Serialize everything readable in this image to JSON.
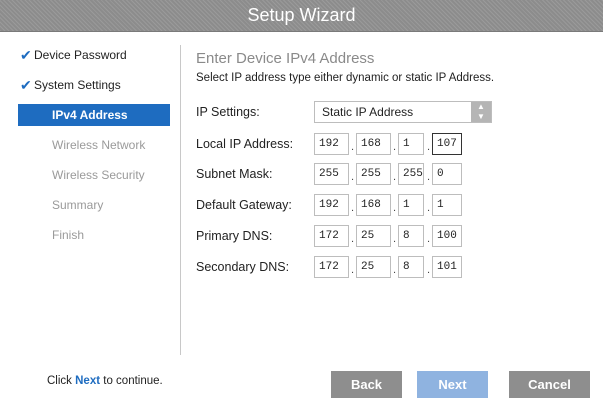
{
  "window": {
    "title": "Setup Wizard"
  },
  "sidebar": {
    "steps": [
      {
        "label": "Device Password",
        "state": "done"
      },
      {
        "label": "System Settings",
        "state": "done"
      },
      {
        "label": "IPv4 Address",
        "state": "active"
      },
      {
        "label": "Wireless Network",
        "state": "pending"
      },
      {
        "label": "Wireless Security",
        "state": "pending"
      },
      {
        "label": "Summary",
        "state": "pending"
      },
      {
        "label": "Finish",
        "state": "pending"
      }
    ],
    "check_icon": "checkmark-icon"
  },
  "main": {
    "heading": "Enter Device IPv4 Address",
    "subheading": "Select IP address type either dynamic or static IP Address.",
    "ip_settings": {
      "label": "IP Settings:",
      "value": "Static IP Address",
      "icon": "updown-chevron-icon"
    },
    "fields": {
      "local_ip": {
        "label": "Local IP Address:",
        "octets": [
          "192",
          "168",
          "1",
          "107"
        ]
      },
      "subnet_mask": {
        "label": "Subnet Mask:",
        "octets": [
          "255",
          "255",
          "255",
          "0"
        ]
      },
      "default_gateway": {
        "label": "Default Gateway:",
        "octets": [
          "192",
          "168",
          "1",
          "1"
        ]
      },
      "primary_dns": {
        "label": "Primary DNS:",
        "octets": [
          "172",
          "25",
          "8",
          "100"
        ]
      },
      "secondary_dns": {
        "label": "Secondary DNS:",
        "octets": [
          "172",
          "25",
          "8",
          "101"
        ]
      }
    },
    "separator": "."
  },
  "footer": {
    "hint_prefix": "Click",
    "hint_next": "Next",
    "hint_suffix": "to continue.",
    "buttons": {
      "back": "Back",
      "next": "Next",
      "cancel": "Cancel"
    }
  },
  "colors": {
    "accent": "#1e6cc0",
    "next_button": "#8fb3e0",
    "gray_button": "#8e8e8e",
    "titlebar": "#939393"
  }
}
